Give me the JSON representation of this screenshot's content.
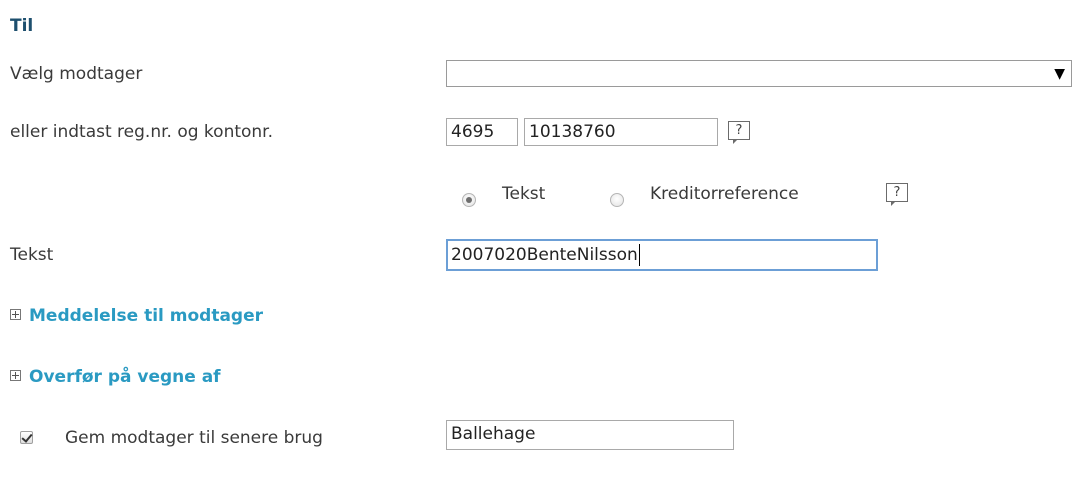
{
  "section": {
    "title": "Til"
  },
  "recipient": {
    "label": "Vælg modtager",
    "selected_value": "",
    "arrow_glyph": "▼"
  },
  "account": {
    "label": "eller indtast reg.nr. og kontonr.",
    "reg_nr": "4695",
    "konto_nr": "10138760",
    "help_glyph": "?"
  },
  "reference_type": {
    "options": [
      {
        "label": "Tekst",
        "selected": true
      },
      {
        "label": "Kreditorreference",
        "selected": false
      }
    ],
    "help_glyph": "?"
  },
  "text_field": {
    "label": "Tekst",
    "value": "2007020BenteNilsson"
  },
  "expanders": {
    "message": "Meddelelse til modtager",
    "on_behalf": "Overfør på vegne af"
  },
  "save_recipient": {
    "label": "Gem modtager til senere brug",
    "checked": true,
    "name_value": "Ballehage"
  },
  "colors": {
    "title": "#1d4f6e",
    "link": "#2a9ac2",
    "focus_border": "#6c9fd6"
  }
}
